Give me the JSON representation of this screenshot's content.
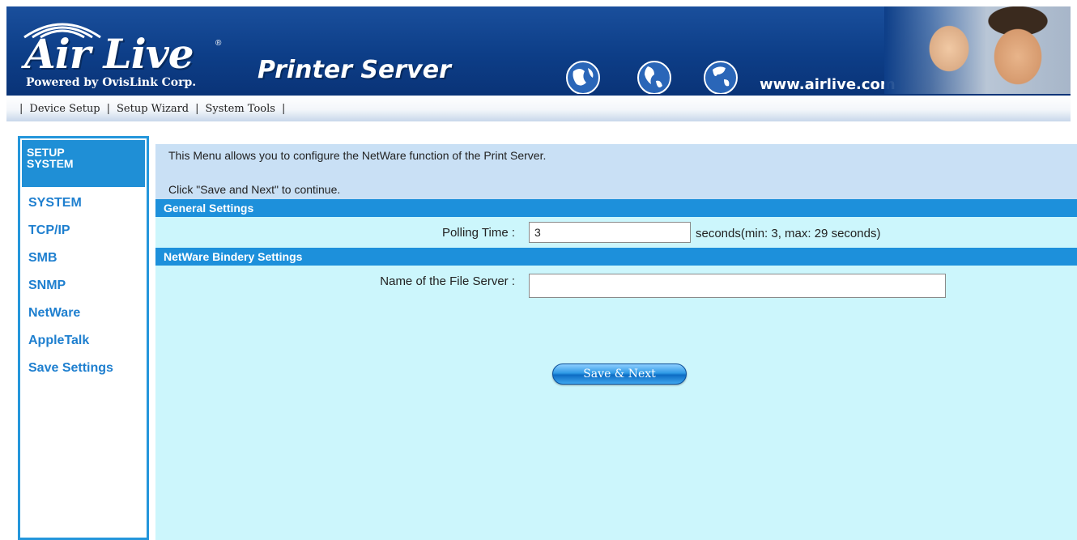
{
  "banner": {
    "logo_text": "Air Live",
    "logo_registered": "®",
    "logo_subtitle": "Powered by OvisLink Corp.",
    "product_title": "Printer Server",
    "url": "www.airlive.com"
  },
  "topnav": {
    "items": [
      "Device Setup",
      "Setup Wizard",
      "System Tools"
    ]
  },
  "sidebar": {
    "header_line1": "SETUP",
    "header_line2": "SYSTEM",
    "items": [
      "SYSTEM",
      "TCP/IP",
      "SMB",
      "SNMP",
      "NetWare",
      "AppleTalk",
      "Save Settings"
    ]
  },
  "main": {
    "intro_line1": "This Menu allows you to configure the NetWare function of the Print Server.",
    "intro_line2": "Click \"Save and Next\" to continue.",
    "general": {
      "title": "General Settings",
      "polling_label": "Polling Time :",
      "polling_value": "3",
      "polling_unit": "seconds(min: 3, max: 29 seconds)"
    },
    "bindery": {
      "title": "NetWare Bindery Settings",
      "file_server_label": "Name of the File Server :",
      "file_server_value": ""
    },
    "save_button": "Save & Next"
  },
  "colors": {
    "banner_blue": "#0d3e88",
    "section_blue": "#1d90db",
    "content_bg": "#ccf6fc",
    "intro_bg": "#c9e0f5",
    "sidebar_link": "#1e7fcf"
  }
}
